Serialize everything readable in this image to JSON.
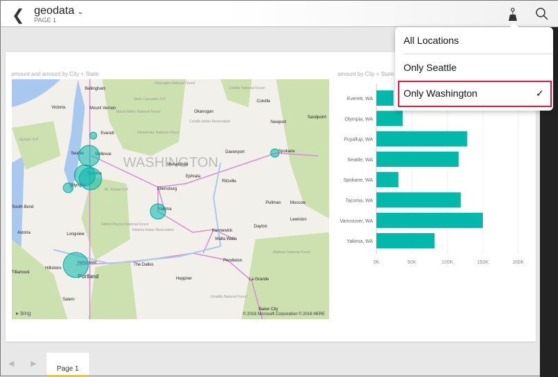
{
  "header": {
    "title": "geodata",
    "subtitle": "PAGE 1"
  },
  "filter_menu": {
    "options": [
      "All Locations",
      "Only Seattle",
      "Only Washington"
    ],
    "selected": "Only Washington",
    "check": "✓"
  },
  "map_visual": {
    "title": "amount and amount by City + State",
    "attribution": "© 2016 Microsoft Corporation   © 2016 HERE",
    "logo": "bing",
    "state_label": "WASHINGTON",
    "cities": [
      "Bellingham",
      "Mount Vernon",
      "Everett",
      "Seattle",
      "Bellevue",
      "Tacoma",
      "Olympia",
      "Okanogan",
      "Colville",
      "Newport",
      "Sandpoint",
      "Davenport",
      "Spokane",
      "Wenatchee",
      "Ephrata",
      "Ritzville",
      "Ellensburg",
      "Yakima",
      "Pullman",
      "Moscow",
      "Lewiston",
      "Kennewick",
      "Walla Walla",
      "Dayton",
      "Longview",
      "Astoria",
      "South Bend",
      "Vancouver",
      "Portland",
      "Hillsboro",
      "Tillamook",
      "The Dalles",
      "Pendleton",
      "La Grande",
      "Heppner",
      "Salem",
      "Baker City",
      "Victoria"
    ],
    "parks": [
      "Olympic N.P.",
      "Mount Baker National Forest",
      "North Cascades N.P.",
      "Okanogan National Forest",
      "Colville National Forest",
      "Wenatchee National Forest",
      "Colville Indian Reservation",
      "Mt. Rainier N.P.",
      "Gifford Pinchot National Forest",
      "Yakama Indian Reservation",
      "Wallowa National Forest",
      "Umatilla National Forest"
    ]
  },
  "chart_data": {
    "type": "bar",
    "title": "amount by City + State",
    "categories": [
      "Everett, WA",
      "Olympia, WA",
      "Puyallup, WA",
      "Seattle, WA",
      "Spokane, WA",
      "Tacoma, WA",
      "Vancouver, WA",
      "Yakima, WA"
    ],
    "values": [
      24000,
      37000,
      128000,
      116000,
      31000,
      119000,
      150000,
      82000
    ],
    "xlim": [
      0,
      200000
    ],
    "ticks": [
      "0K",
      "50K",
      "100K",
      "150K",
      "200K"
    ],
    "color": "#01b8aa"
  },
  "pages": {
    "current": "Page 1"
  }
}
